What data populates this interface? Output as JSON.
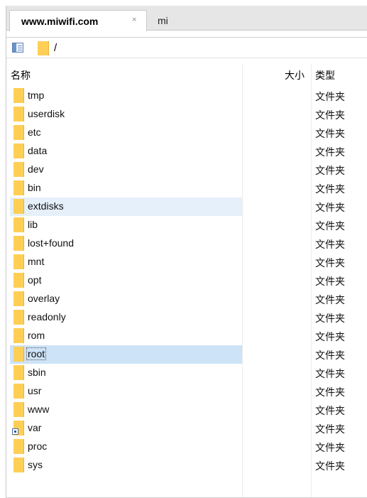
{
  "tabs": [
    {
      "label": "www.miwifi.com",
      "close": "×",
      "active": true
    },
    {
      "label": "mi",
      "active": false
    }
  ],
  "path": "/",
  "columns": {
    "name": "名称",
    "size": "大小",
    "type": "类型"
  },
  "rows": [
    {
      "name": "tmp",
      "type": "文件夹"
    },
    {
      "name": "userdisk",
      "type": "文件夹"
    },
    {
      "name": "etc",
      "type": "文件夹"
    },
    {
      "name": "data",
      "type": "文件夹"
    },
    {
      "name": "dev",
      "type": "文件夹"
    },
    {
      "name": "bin",
      "type": "文件夹"
    },
    {
      "name": "extdisks",
      "type": "文件夹",
      "state": "selected"
    },
    {
      "name": "lib",
      "type": "文件夹"
    },
    {
      "name": "lost+found",
      "type": "文件夹"
    },
    {
      "name": "mnt",
      "type": "文件夹"
    },
    {
      "name": "opt",
      "type": "文件夹"
    },
    {
      "name": "overlay",
      "type": "文件夹"
    },
    {
      "name": "readonly",
      "type": "文件夹"
    },
    {
      "name": "rom",
      "type": "文件夹"
    },
    {
      "name": "root",
      "type": "文件夹",
      "state": "focused"
    },
    {
      "name": "sbin",
      "type": "文件夹"
    },
    {
      "name": "usr",
      "type": "文件夹"
    },
    {
      "name": "www",
      "type": "文件夹"
    },
    {
      "name": "var",
      "type": "文件夹",
      "link": true
    },
    {
      "name": "proc",
      "type": "文件夹"
    },
    {
      "name": "sys",
      "type": "文件夹"
    }
  ],
  "colors": {
    "folder": "#ffcf55",
    "selection": "#e5f0fb",
    "focus": "#cde3f7"
  }
}
